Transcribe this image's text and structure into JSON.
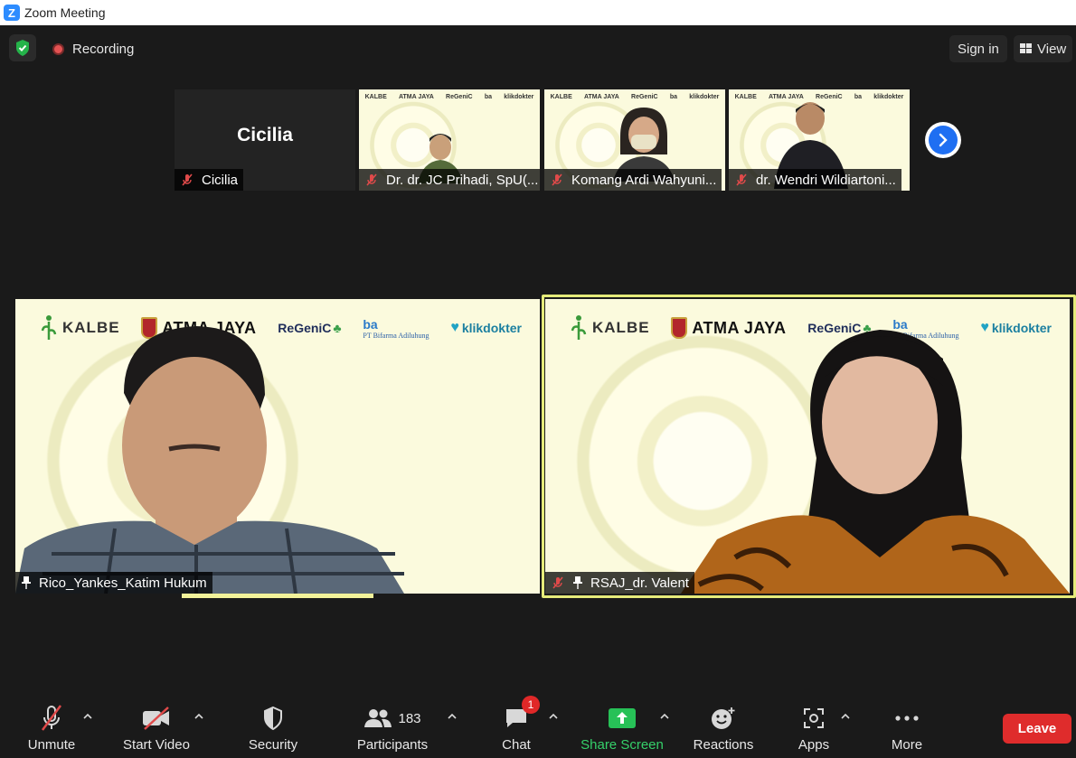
{
  "window": {
    "title": "Zoom Meeting"
  },
  "topbar": {
    "security_icon": "shield-check-icon",
    "recording_label": "Recording",
    "signin_label": "Sign in",
    "view_label": "View"
  },
  "thumbnails": [
    {
      "display_name": "Cicilia",
      "name": "Cicilia",
      "muted": true
    },
    {
      "name": "Dr. dr. JC Prihadi, SpU(...",
      "muted": true
    },
    {
      "name": "Komang Ardi Wahyuni...",
      "muted": true
    },
    {
      "name": "dr. Wendri Wildiartoni...",
      "muted": true
    }
  ],
  "mini_logos": [
    "KALBE",
    "ATMA JAYA",
    "ReGeniC",
    "ba",
    "klikdokter"
  ],
  "tiles": [
    {
      "name": "Rico_Yankes_Katim Hukum",
      "pinned": true,
      "muted": false
    },
    {
      "name": "RSAJ_dr. Valent",
      "pinned": true,
      "muted": true,
      "active_speaker": true
    }
  ],
  "logos": {
    "kalbe": "KALBE",
    "atma": "ATMA JAYA",
    "regenic": "ReGeniC",
    "bifarma_mark": "ba",
    "bifarma": "PT Bifarma Adiluhung",
    "klik": "klikdokter"
  },
  "toolbar": {
    "unmute": "Unmute",
    "start_video": "Start Video",
    "security": "Security",
    "participants": "Participants",
    "participants_count": "183",
    "chat": "Chat",
    "chat_badge": "1",
    "share_screen": "Share Screen",
    "reactions": "Reactions",
    "apps": "Apps",
    "more": "More",
    "leave": "Leave"
  },
  "colors": {
    "background": "#1a1a1a",
    "accent_blue": "#2d8cff",
    "share_green": "#35d06a",
    "leave_red": "#df2c2c",
    "speaker_border": "#e5eb7a"
  }
}
